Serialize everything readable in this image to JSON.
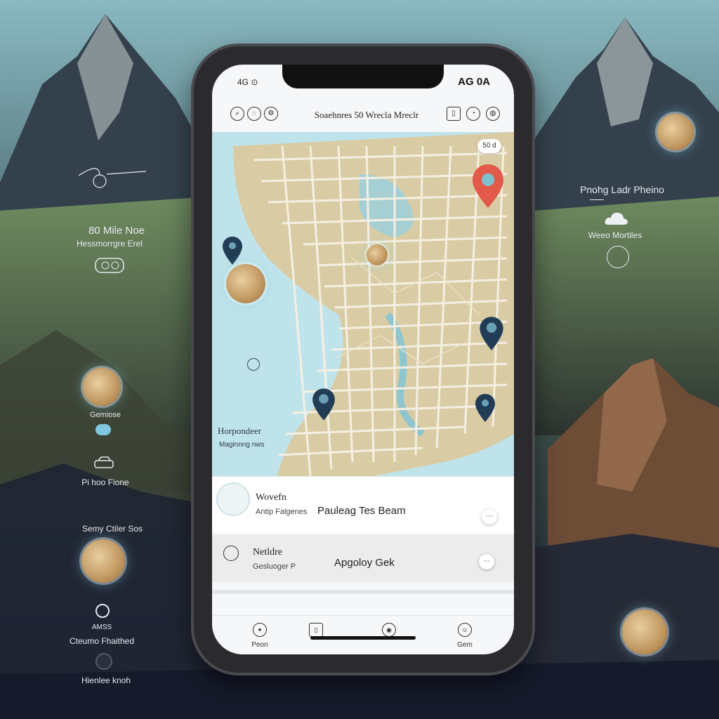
{
  "colors": {
    "accent_red": "#e25a4a",
    "pin_navy": "#213c55",
    "water": "#bfe3ea",
    "land": "#d9cca4",
    "road": "#f4efe2"
  },
  "left_panel": {
    "title": "80 Mile Noe",
    "subtitle": "Hessmorrgre Erel",
    "medallion_label": "Gemiose",
    "item_label": "Pi hoo Fione",
    "item_caption": "Semy Ctiler Sos",
    "item2_icon_label": "AMSS",
    "item2_caption": "Cteumo Fhaithed",
    "item3_caption": "Hienlee knoh"
  },
  "right_panel": {
    "title": "Pnohg Ladr Pheino",
    "subtitle": "Weeo Mortiles"
  },
  "status_bar": {
    "left": "4G ⊙",
    "right": "AG 0A"
  },
  "top_bar": {
    "title": "Soaehnres 50 Wrecla Mreclr"
  },
  "map": {
    "distance_badge": "50 d",
    "city_label": "Horpondeer",
    "city_sublabel": "Maginnng nws"
  },
  "cards": [
    {
      "title": "Wovefn",
      "subtitle": "Antip Falgenes",
      "main": "Pauleag Tes Beam"
    },
    {
      "title": "Netldre",
      "subtitle": "Gesluoger P",
      "main": "Apgoloy Gek"
    }
  ],
  "bottom_nav": [
    {
      "icon": "compass-icon",
      "label": "Peon"
    },
    {
      "icon": "bookmark-icon",
      "label": ""
    },
    {
      "icon": "camera-icon",
      "label": ""
    },
    {
      "icon": "profile-icon",
      "label": "Gem"
    }
  ]
}
